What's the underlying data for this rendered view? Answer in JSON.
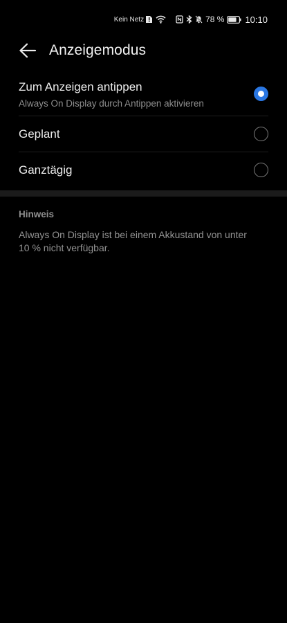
{
  "status_bar": {
    "network_text": "Kein Netz",
    "battery_percent": "78 %",
    "battery_level": 0.78,
    "time": "10:10",
    "icons": [
      "sim-alert-icon",
      "wifi-icon",
      "nfc-icon",
      "bluetooth-icon",
      "bell-off-icon",
      "battery-icon"
    ]
  },
  "header": {
    "title": "Anzeigemodus",
    "back_icon": "arrow-left-icon"
  },
  "options": [
    {
      "title": "Zum Anzeigen antippen",
      "subtitle": "Always On Display durch Antippen aktivieren",
      "selected": true
    },
    {
      "title": "Geplant",
      "selected": false
    },
    {
      "title": "Ganztägig",
      "selected": false
    }
  ],
  "note": {
    "label": "Hinweis",
    "text": "Always On Display ist bei einem Akkustand von unter 10 % nicht verfügbar."
  },
  "colors": {
    "background": "#000000",
    "accent": "#2a77e3"
  }
}
